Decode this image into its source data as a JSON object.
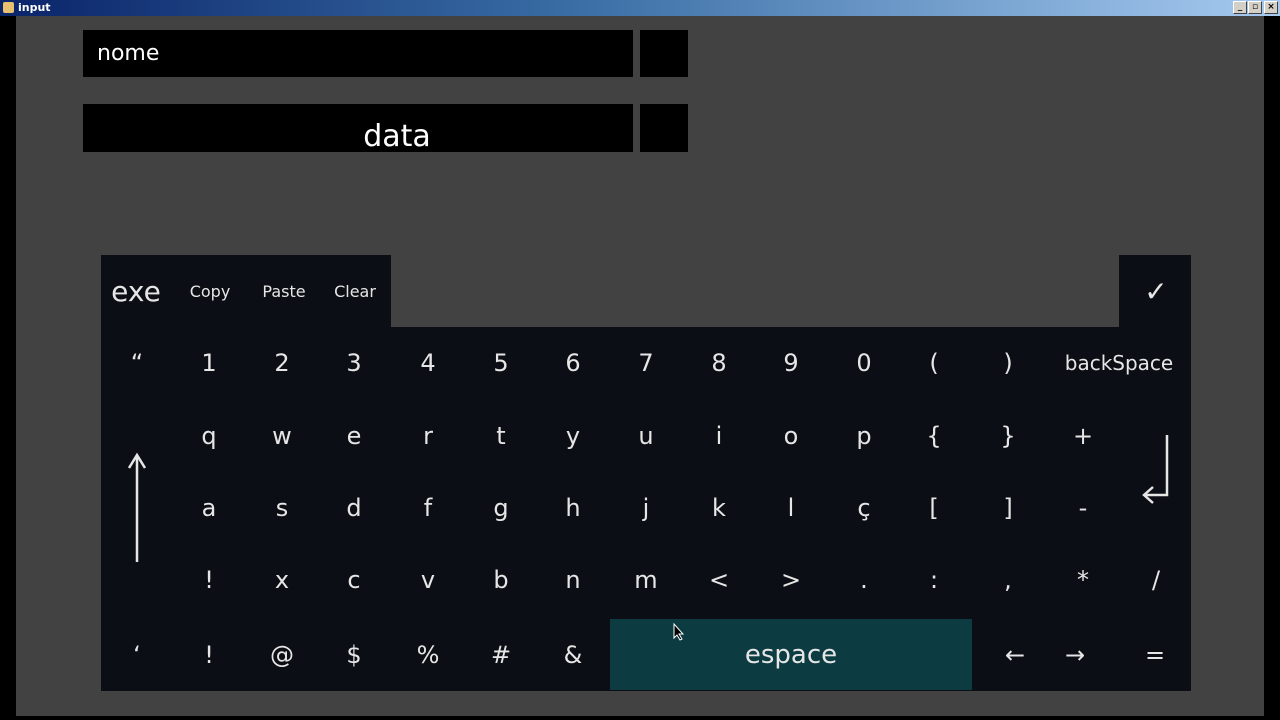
{
  "window": {
    "title": "input"
  },
  "fields": {
    "nome": "nome",
    "data": "data"
  },
  "toolbar": {
    "exe": "exe",
    "copy": "Copy",
    "paste": "Paste",
    "clear": "Clear",
    "confirm": "✓"
  },
  "rows": {
    "r1": [
      "“",
      "1",
      "2",
      "3",
      "4",
      "5",
      "6",
      "7",
      "8",
      "9",
      "0",
      "(",
      ")"
    ],
    "backspace": "backSpace",
    "r2": [
      "q",
      "w",
      "e",
      "r",
      "t",
      "y",
      "u",
      "i",
      "o",
      "p",
      "{",
      "}",
      "+"
    ],
    "r3": [
      "a",
      "s",
      "d",
      "f",
      "g",
      "h",
      "j",
      "k",
      "l",
      "ç",
      "[",
      "]",
      "-"
    ],
    "r4": [
      "!",
      "x",
      "c",
      "v",
      "b",
      "n",
      "m",
      "<",
      ">",
      ".",
      ":",
      ",",
      "*",
      "/"
    ],
    "r5": [
      "‘",
      "!",
      "@",
      "$",
      "%",
      "#",
      "&"
    ],
    "space": "espace",
    "r5_right": [
      "←",
      "→",
      "="
    ]
  },
  "icons": {
    "shift": "up-arrow-icon",
    "enter": "enter-return-icon"
  }
}
